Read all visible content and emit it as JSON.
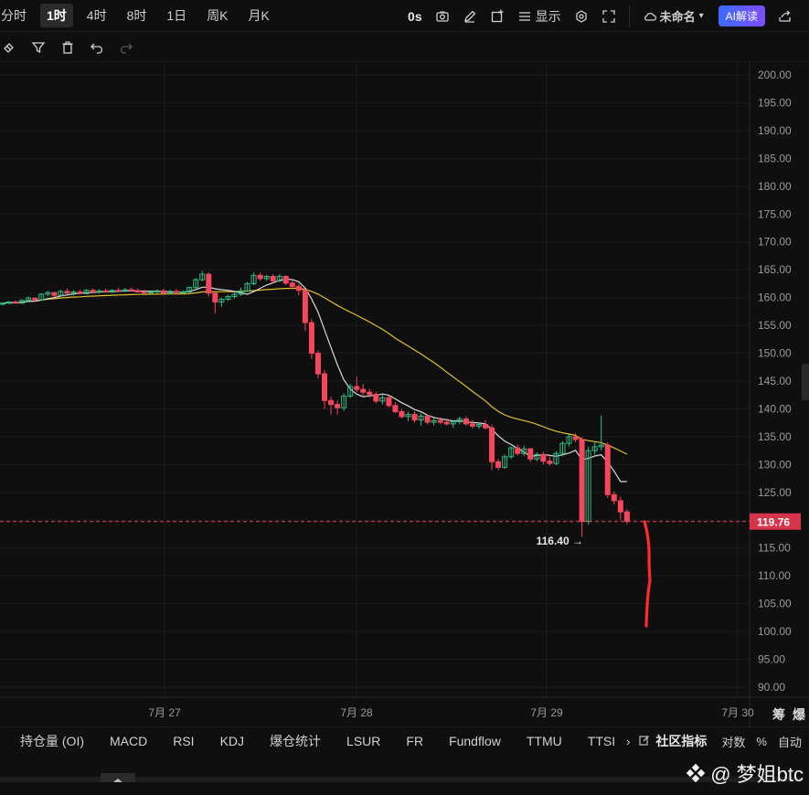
{
  "topbar": {
    "timeframes": [
      "分时",
      "1时",
      "4时",
      "8时",
      "1日",
      "周K",
      "月K"
    ],
    "active": "1时",
    "countdown": "0s",
    "display_label": "显示",
    "layout_name": "未命名",
    "ai_label": "AI解读"
  },
  "bottom": {
    "tabs": [
      "持仓量 (OI)",
      "MACD",
      "RSI",
      "KDJ",
      "爆仓统计",
      "LSUR",
      "FR",
      "Fundflow",
      "TTMU",
      "TTSI"
    ],
    "more": "›",
    "community": "社区指标",
    "log": "对数",
    "percent": "%",
    "auto": "自动"
  },
  "side_labels": [
    "筹",
    "爆"
  ],
  "watermark": "@ 梦姐btc",
  "colors": {
    "up": "#2ebd85",
    "down": "#f6465d",
    "ma_fast": "#d9d9d9",
    "ma_slow": "#e0c02c",
    "price_line": "#e8425a"
  },
  "chart_data": {
    "type": "candlestick",
    "y_ticks": [
      "200.00",
      "195.00",
      "190.00",
      "185.00",
      "180.00",
      "175.00",
      "170.00",
      "165.00",
      "160.00",
      "155.00",
      "150.00",
      "145.00",
      "140.00",
      "135.00",
      "130.00",
      "125.00",
      "120.00",
      "115.00",
      "110.00",
      "105.00",
      "100.00",
      "95.00",
      "90.00"
    ],
    "x_ticks": [
      "7月 27",
      "7月 28",
      "7月 29",
      "7月 30"
    ],
    "ylim": [
      90,
      200
    ],
    "current_price": "119.76",
    "low_label": "116.40",
    "candles": [
      [
        158.8,
        159.1,
        158.6,
        159.0
      ],
      [
        159.0,
        159.4,
        158.8,
        159.2
      ],
      [
        159.2,
        159.5,
        158.9,
        159.0
      ],
      [
        159.0,
        159.7,
        158.9,
        159.5
      ],
      [
        159.5,
        160.2,
        159.3,
        159.9
      ],
      [
        159.9,
        160.0,
        159.2,
        159.6
      ],
      [
        159.6,
        160.8,
        159.5,
        160.6
      ],
      [
        160.6,
        161.2,
        160.2,
        160.9
      ],
      [
        160.9,
        161.0,
        160.1,
        160.4
      ],
      [
        160.4,
        161.4,
        160.3,
        161.1
      ],
      [
        161.1,
        161.6,
        160.5,
        160.8
      ],
      [
        160.8,
        161.3,
        160.4,
        161.0
      ],
      [
        161.0,
        161.4,
        160.6,
        160.7
      ],
      [
        160.7,
        161.5,
        160.6,
        161.3
      ],
      [
        161.3,
        161.6,
        160.8,
        161.0
      ],
      [
        161.0,
        161.5,
        160.7,
        161.2
      ],
      [
        161.2,
        161.6,
        160.9,
        161.0
      ],
      [
        161.0,
        161.5,
        160.8,
        161.3
      ],
      [
        161.3,
        161.8,
        161.0,
        161.2
      ],
      [
        161.2,
        161.7,
        160.9,
        161.4
      ],
      [
        161.4,
        161.8,
        161.1,
        161.2
      ],
      [
        161.2,
        161.6,
        160.9,
        161.0
      ],
      [
        161.0,
        161.4,
        160.7,
        160.9
      ],
      [
        160.9,
        161.3,
        160.6,
        161.0
      ],
      [
        161.0,
        161.5,
        160.8,
        161.2
      ],
      [
        161.2,
        161.6,
        160.9,
        160.8
      ],
      [
        160.8,
        161.4,
        160.6,
        161.1
      ],
      [
        161.1,
        161.5,
        160.8,
        160.9
      ],
      [
        160.9,
        161.3,
        160.6,
        161.0
      ],
      [
        161.0,
        162.0,
        160.8,
        161.8
      ],
      [
        161.8,
        163.5,
        161.5,
        163.2
      ],
      [
        163.2,
        164.8,
        162.9,
        164.2
      ],
      [
        164.2,
        164.5,
        160.2,
        160.8
      ],
      [
        160.8,
        161.0,
        157.2,
        159.2
      ],
      [
        159.2,
        160.0,
        158.3,
        159.7
      ],
      [
        159.7,
        160.5,
        159.4,
        160.2
      ],
      [
        160.2,
        161.0,
        159.8,
        160.6
      ],
      [
        160.6,
        161.8,
        160.3,
        161.2
      ],
      [
        161.2,
        162.8,
        161.0,
        162.5
      ],
      [
        162.5,
        164.5,
        162.2,
        164.0
      ],
      [
        164.0,
        164.5,
        163.0,
        163.4
      ],
      [
        163.4,
        164.1,
        163.0,
        163.8
      ],
      [
        163.8,
        164.2,
        162.6,
        163.0
      ],
      [
        163.0,
        164.2,
        162.8,
        163.8
      ],
      [
        163.8,
        164.0,
        162.2,
        162.6
      ],
      [
        162.6,
        163.2,
        161.5,
        162.0
      ],
      [
        162.0,
        162.5,
        160.4,
        161.3
      ],
      [
        161.3,
        161.6,
        154.0,
        155.5
      ],
      [
        155.5,
        156.2,
        149.0,
        150.0
      ],
      [
        150.0,
        150.5,
        145.5,
        146.3
      ],
      [
        146.3,
        147.0,
        140.0,
        141.5
      ],
      [
        141.5,
        142.2,
        139.0,
        140.8
      ],
      [
        140.8,
        141.5,
        139.0,
        140.2
      ],
      [
        140.2,
        142.8,
        139.6,
        142.3
      ],
      [
        142.3,
        144.5,
        142.0,
        144.0
      ],
      [
        144.0,
        145.8,
        143.0,
        143.5
      ],
      [
        143.5,
        144.5,
        142.4,
        143.0
      ],
      [
        143.0,
        143.6,
        142.0,
        142.6
      ],
      [
        142.6,
        143.1,
        141.0,
        141.4
      ],
      [
        141.4,
        142.6,
        140.8,
        142.0
      ],
      [
        142.0,
        142.4,
        140.2,
        140.6
      ],
      [
        140.6,
        141.2,
        139.2,
        139.5
      ],
      [
        139.5,
        140.0,
        138.3,
        138.6
      ],
      [
        138.6,
        139.5,
        137.8,
        139.0
      ],
      [
        139.0,
        139.6,
        137.5,
        138.0
      ],
      [
        138.0,
        139.2,
        137.0,
        138.7
      ],
      [
        138.7,
        139.0,
        137.2,
        137.6
      ],
      [
        137.6,
        138.4,
        137.0,
        137.9
      ],
      [
        137.9,
        138.5,
        137.2,
        137.6
      ],
      [
        137.6,
        138.3,
        137.0,
        137.3
      ],
      [
        137.3,
        138.0,
        136.6,
        137.7
      ],
      [
        137.7,
        138.6,
        137.2,
        138.2
      ],
      [
        138.2,
        138.7,
        137.0,
        137.3
      ],
      [
        137.3,
        138.0,
        136.5,
        136.9
      ],
      [
        136.9,
        137.6,
        136.4,
        137.2
      ],
      [
        137.2,
        138.0,
        136.3,
        136.6
      ],
      [
        136.6,
        137.2,
        129.0,
        130.5
      ],
      [
        130.5,
        131.0,
        129.0,
        129.5
      ],
      [
        129.5,
        131.8,
        129.2,
        131.4
      ],
      [
        131.4,
        133.2,
        131.0,
        133.0
      ],
      [
        133.0,
        133.6,
        131.6,
        132.0
      ],
      [
        132.0,
        133.4,
        131.5,
        132.8
      ],
      [
        132.8,
        133.0,
        130.5,
        131.0
      ],
      [
        131.0,
        132.2,
        130.6,
        131.8
      ],
      [
        131.8,
        132.3,
        130.0,
        130.6
      ],
      [
        130.6,
        131.4,
        129.8,
        130.2
      ],
      [
        130.2,
        132.4,
        129.9,
        132.0
      ],
      [
        132.0,
        134.2,
        131.5,
        133.8
      ],
      [
        133.8,
        135.4,
        133.2,
        135.0
      ],
      [
        135.0,
        135.6,
        134.0,
        134.5
      ],
      [
        134.5,
        134.9,
        117.0,
        119.8
      ],
      [
        119.8,
        133.2,
        119.2,
        132.5
      ],
      [
        132.5,
        134.2,
        131.8,
        133.2
      ],
      [
        133.2,
        138.8,
        132.5,
        133.5
      ],
      [
        133.5,
        134.0,
        124.0,
        124.6
      ],
      [
        124.6,
        125.2,
        122.8,
        123.5
      ],
      [
        123.5,
        124.2,
        120.0,
        121.5
      ],
      [
        121.5,
        122.0,
        119.3,
        119.8
      ]
    ],
    "drawn_line": {
      "from": 119.76,
      "to": 101.0
    }
  }
}
